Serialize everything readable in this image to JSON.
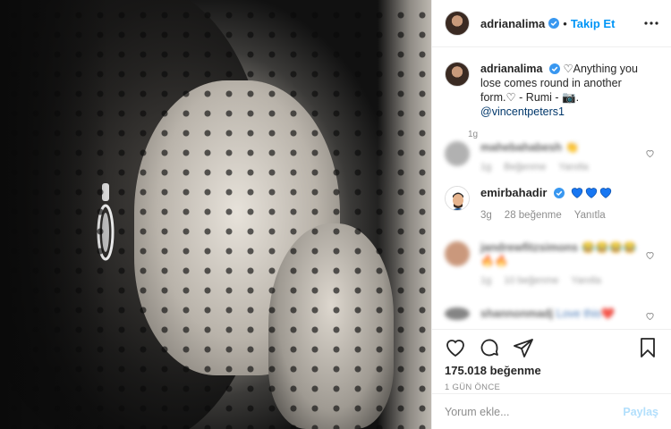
{
  "post": {
    "image_alt": "Black and white portrait with polka-dot veil"
  },
  "header": {
    "username": "adrianalima",
    "separator": "•",
    "follow_label": "Takip Et"
  },
  "caption": {
    "username": "adrianalima",
    "text": " ♡Anything you lose comes round in another form.♡ - Rumi - 📷. ",
    "mention": "@vincentpeters1",
    "time": "1g"
  },
  "comments": [
    {
      "username": "mahebahabesh",
      "text": "👏",
      "meta": [
        "1g",
        "Beğenme",
        "Yanıtla"
      ],
      "blurred": true
    },
    {
      "username": "emirbahadir",
      "hearts": [
        "💙",
        "💙",
        "💙"
      ],
      "time": "3g",
      "likes": "28 beğenme",
      "reply": "Yanıtla",
      "blurred": false
    },
    {
      "username": "jandrewfitzsimons",
      "text": "😂😂😂😂",
      "text2": "🔥🔥",
      "meta": [
        "1g",
        "10 beğenme",
        "Yanıtla"
      ],
      "blurred": true
    },
    {
      "username": "shannonmadj",
      "text": "Love this❤️",
      "blurred": true
    }
  ],
  "stats": {
    "likes": "175.018 beğenme",
    "date": "1 GÜN ÖNCE"
  },
  "add_comment": {
    "placeholder": "Yorum ekle...",
    "post_label": "Paylaş"
  },
  "colors": {
    "link": "#0095f6",
    "mention": "#00376b",
    "heart_blue": "#1877f2",
    "muted": "#8e8e8e"
  }
}
